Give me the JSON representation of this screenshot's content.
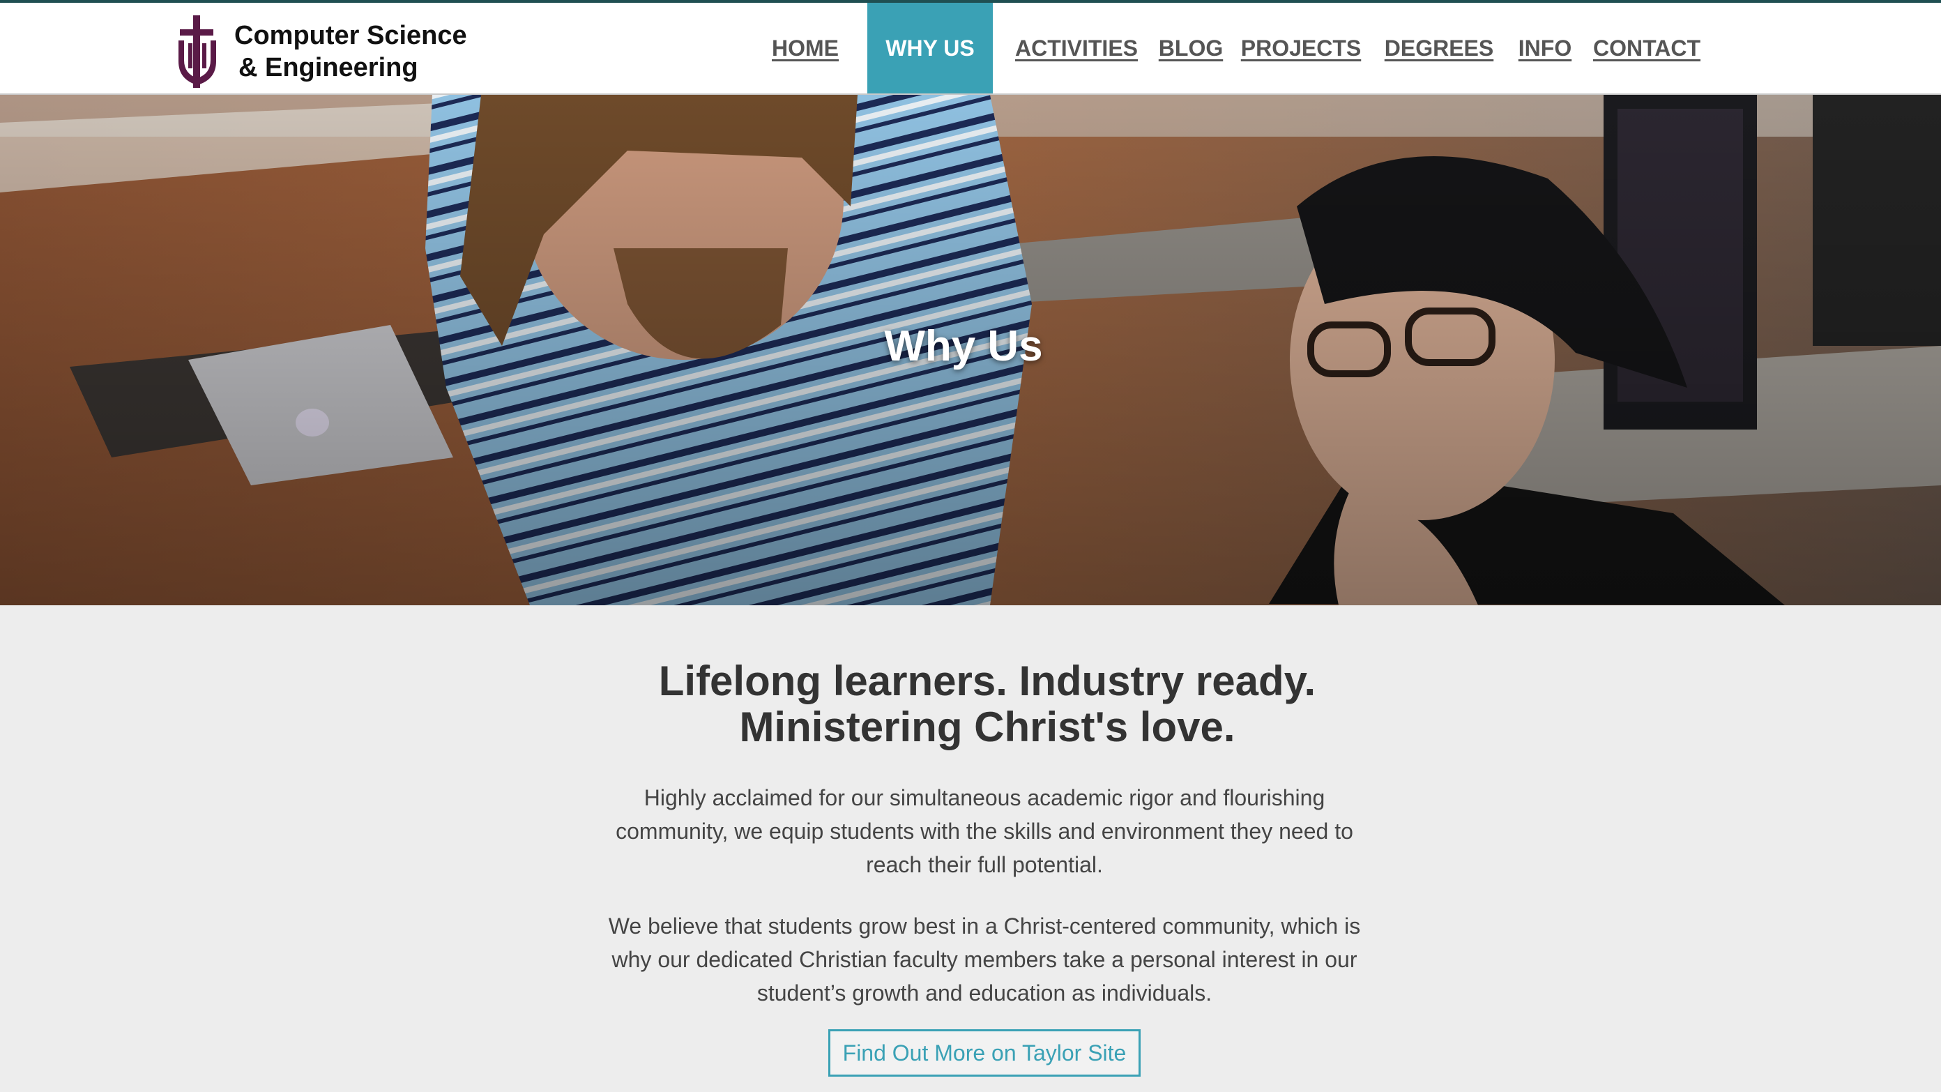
{
  "brand": {
    "line1": "Computer Science",
    "line2": "& Engineering",
    "color": "#5a1a47"
  },
  "nav": {
    "items": [
      {
        "label": "HOME",
        "active": false
      },
      {
        "label": "WHY US",
        "active": true
      },
      {
        "label": "ACTIVITIES",
        "active": false
      },
      {
        "label": "BLOG",
        "active": false
      },
      {
        "label": "PROJECTS",
        "active": false
      },
      {
        "label": "DEGREES",
        "active": false
      },
      {
        "label": "INFO",
        "active": false
      },
      {
        "label": "CONTACT",
        "active": false
      }
    ],
    "active_color": "#3aa1b5"
  },
  "hero": {
    "title": "Why Us"
  },
  "main": {
    "headline_line1": "Lifelong learners. Industry ready.",
    "headline_line2": "Ministering Christ's love.",
    "paragraph1": "Highly acclaimed for our simultaneous academic rigor and flourishing community, we equip students with the skills and environment they need to reach their full potential.",
    "paragraph2": "We believe that students grow best in a Christ-centered community, which is why our dedicated Christian faculty members take a personal interest in our student’s growth and education as individuals.",
    "cta_label": "Find Out More on Taylor Site"
  }
}
